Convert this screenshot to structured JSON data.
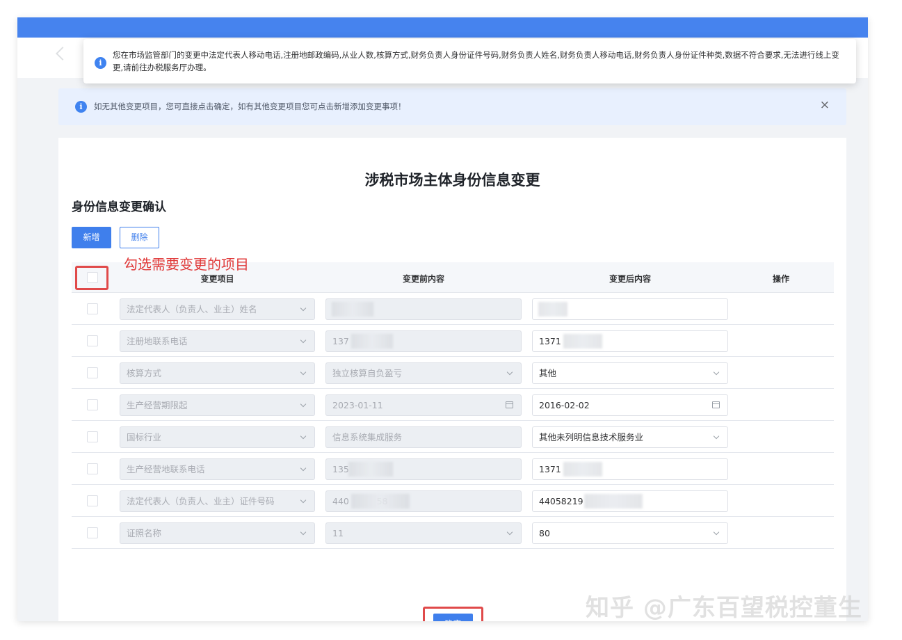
{
  "toast": {
    "icon": "info-icon",
    "message": "您在市场监管部门的变更中法定代表人移动电话,注册地邮政编码,从业人数,核算方式,财务负责人身份证件号码,财务负责人姓名,财务负责人移动电话,财务负责人身份证件种类,数据不符合要求,无法进行线上变更,请前往办税服务厅办理。"
  },
  "notice": {
    "icon": "info-icon",
    "text": "如无其他变更项目，您可直接点击确定，如有其他变更项目您可点击新增添加变更事项！",
    "close": "×"
  },
  "page": {
    "title": "涉税市场主体身份信息变更",
    "section_title": "身份信息变更确认",
    "add_label": "新增",
    "delete_label": "删除",
    "annotation": "勾选需要变更的项目",
    "confirm_label": "确定",
    "watermark": "知乎 @广东百望税控董生"
  },
  "table": {
    "headers": {
      "item": "变更项目",
      "before": "变更前内容",
      "after": "变更后内容",
      "action": "操作"
    },
    "rows": [
      {
        "item": "法定代表人（负责人、业主）姓名",
        "before": "",
        "after": ""
      },
      {
        "item": "注册地联系电话",
        "before": "137",
        "after": "1371"
      },
      {
        "item": "核算方式",
        "before": "独立核算自负盈亏",
        "after": "其他"
      },
      {
        "item": "生产经营期限起",
        "before": "2023-01-11",
        "after": "2016-02-02"
      },
      {
        "item": "国标行业",
        "before": "信息系统集成服务",
        "after": "其他未列明信息技术服务业"
      },
      {
        "item": "生产经营地联系电话",
        "before": "135",
        "after": "1371"
      },
      {
        "item": "法定代表人（负责人、业主）证件号码",
        "before": "440          58",
        "after": "44058219"
      },
      {
        "item": "证照名称",
        "before": "11",
        "after": "80"
      }
    ]
  },
  "colors": {
    "primary": "#3f7fec",
    "topbar": "#4683ee",
    "highlight": "#e04a4a"
  }
}
